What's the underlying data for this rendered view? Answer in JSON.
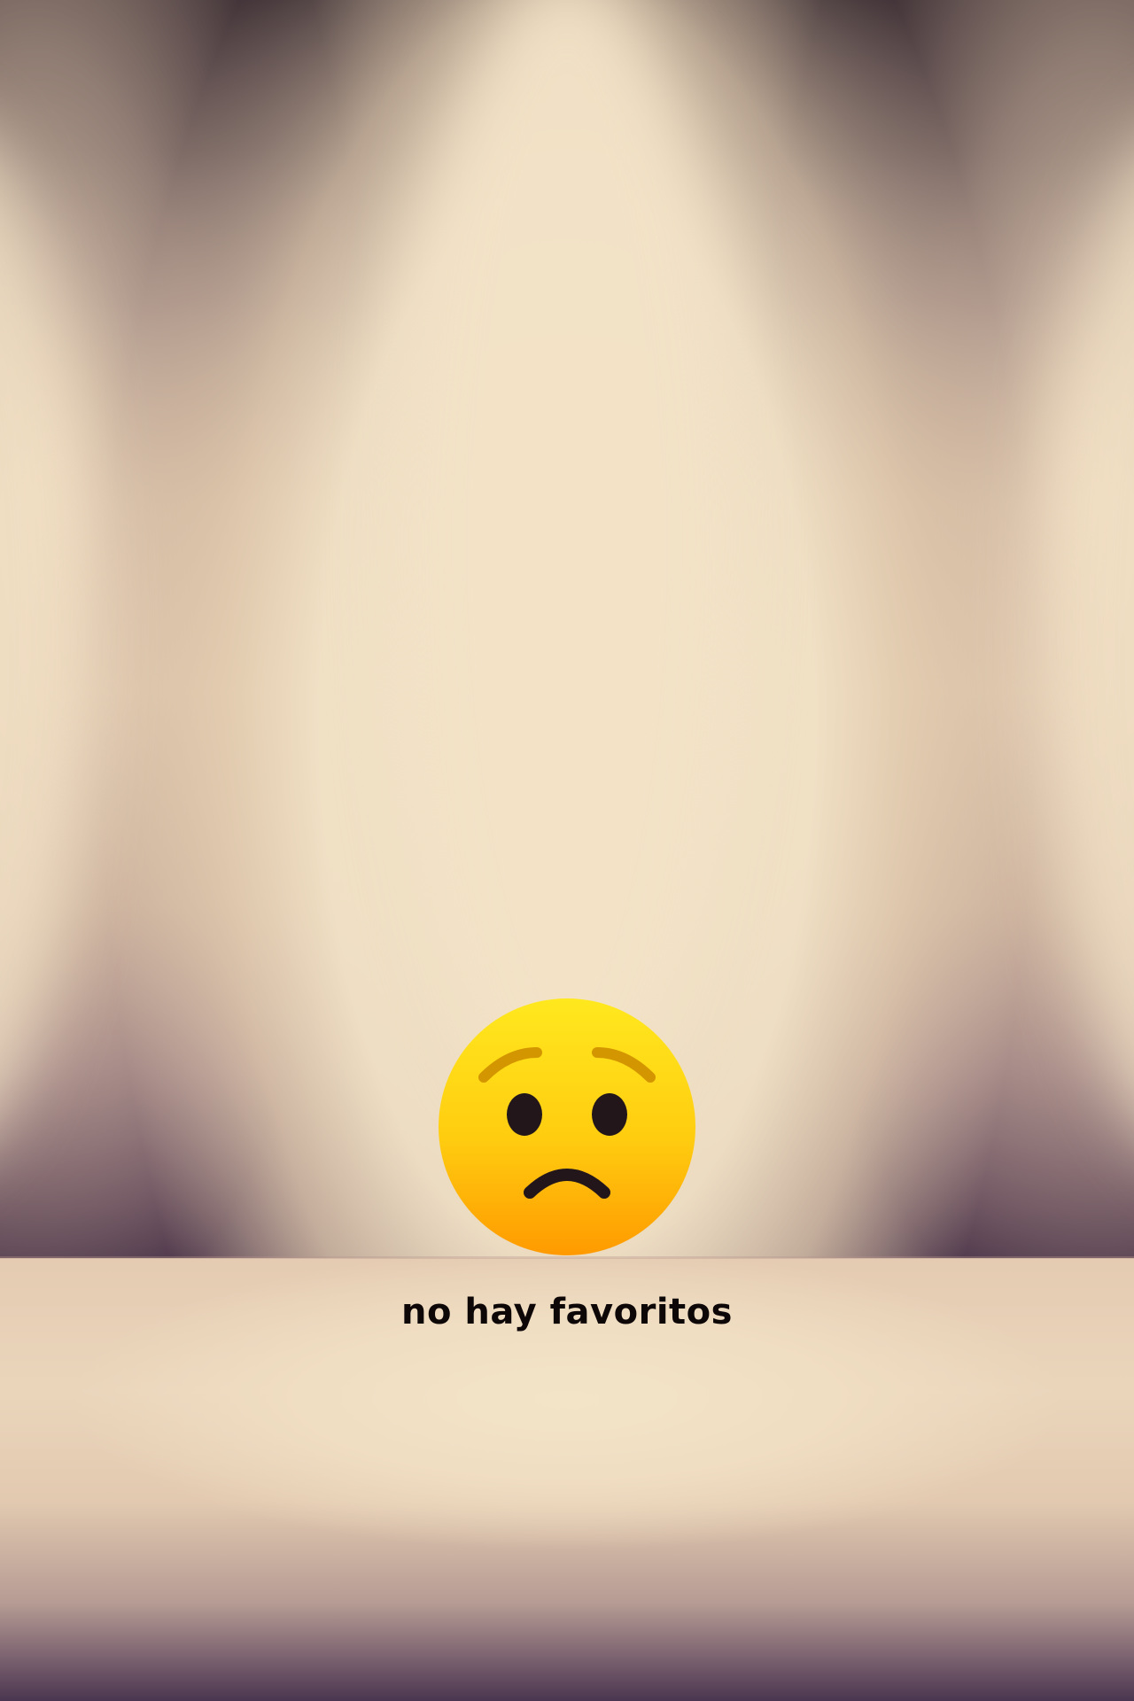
{
  "empty_state": {
    "icon": "worried-face-icon",
    "message": "no hay favoritos"
  },
  "colors": {
    "background_dark": "#1b0f1b",
    "spotlight": "#f2e2c6",
    "text": "#0d0708",
    "emoji_top": "#ffe31f",
    "emoji_bottom": "#ff9b00"
  }
}
